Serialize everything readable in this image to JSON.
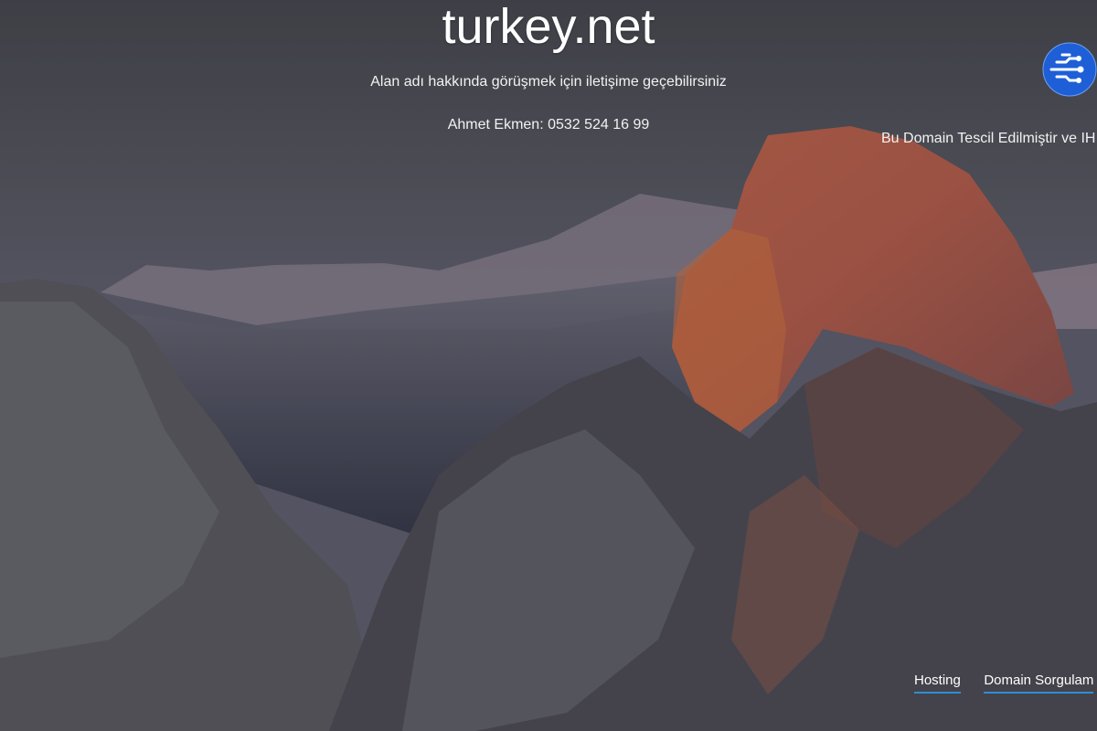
{
  "domain": {
    "title": "turkey.net"
  },
  "message": {
    "subtitle": "Alan adı hakkında görüşmek için iletişime geçebilirsiniz",
    "contact": "Ahmet Ekmen: 0532 524 16 99"
  },
  "notice": {
    "text": "Bu Domain Tescil Edilmiştir ve IH"
  },
  "logo": {
    "icon": "circuit-globe-icon",
    "color": "#1e5fd8"
  },
  "footer": {
    "links": [
      {
        "label": "Hosting"
      },
      {
        "label": "Domain Sorgulam"
      }
    ],
    "underline_color": "#2d8fd5"
  }
}
